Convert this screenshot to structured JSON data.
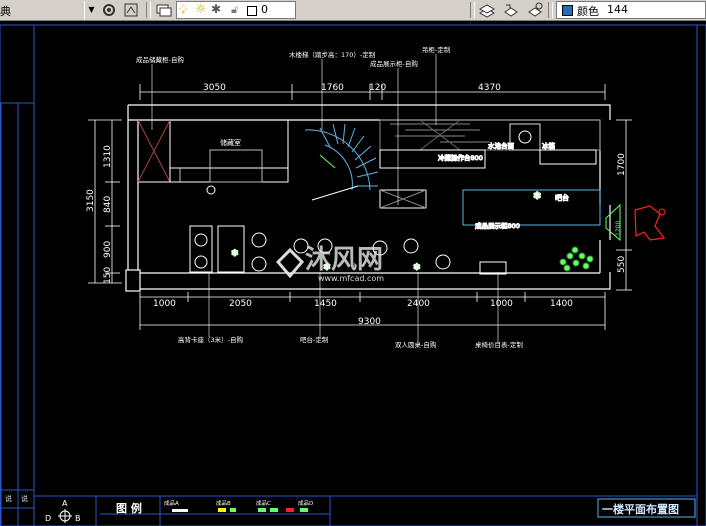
{
  "toolbar": {
    "style_partial": "典",
    "layer_value": "0",
    "color_label": "颜色",
    "color_value": "144",
    "color_swatch": "#1e6fb5"
  },
  "drawing": {
    "top_dims": [
      "3050",
      "1760",
      "120",
      "4370"
    ],
    "bottom_dims": [
      "1000",
      "2050",
      "1450",
      "2400",
      "1000",
      "1400"
    ],
    "total_dim": "9300",
    "left_dims": [
      "1310",
      "840",
      "900",
      "150"
    ],
    "left_total": "3150",
    "right_dims": [
      "1700",
      "550"
    ],
    "top_labels": [
      "木楼梯（踏步高：170）-定制",
      "吊柜-定制",
      "成品储藏柜-自购",
      "成品展示柜-自购"
    ],
    "bottom_labels": [
      "高背卡座（3米）-自购",
      "吧台-定制",
      "双人圆桌-自购",
      "桌椅价目表-定制"
    ],
    "rooms": [
      "储藏室",
      "吧台",
      "冷藏操作台800",
      "冰箱",
      "水池台面",
      "成品展示柜800"
    ],
    "door_label": "1200",
    "title": "一楼平面布置图",
    "legend_title": "图 例",
    "legend_items": [
      "成品A",
      "成品B",
      "成品C",
      "成品D"
    ],
    "compass": [
      "A",
      "B",
      "D"
    ],
    "watermark_brand": "沐风网",
    "watermark_url": "www.mfcad.com"
  }
}
